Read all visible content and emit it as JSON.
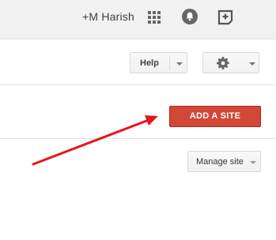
{
  "header": {
    "user_name": "+M Harish",
    "icons": [
      "apps-grid-icon",
      "notifications-bell-icon",
      "share-plus-icon"
    ]
  },
  "toolbar": {
    "help_label": "Help",
    "settings_icon": "gear-icon"
  },
  "main": {
    "add_site_label": "ADD A SITE",
    "manage_site_label": "Manage site"
  },
  "annotation": {
    "arrow_color": "#e8141c"
  },
  "colors": {
    "accent_red": "#d14836",
    "topbar_bg": "#f1f1f1"
  }
}
